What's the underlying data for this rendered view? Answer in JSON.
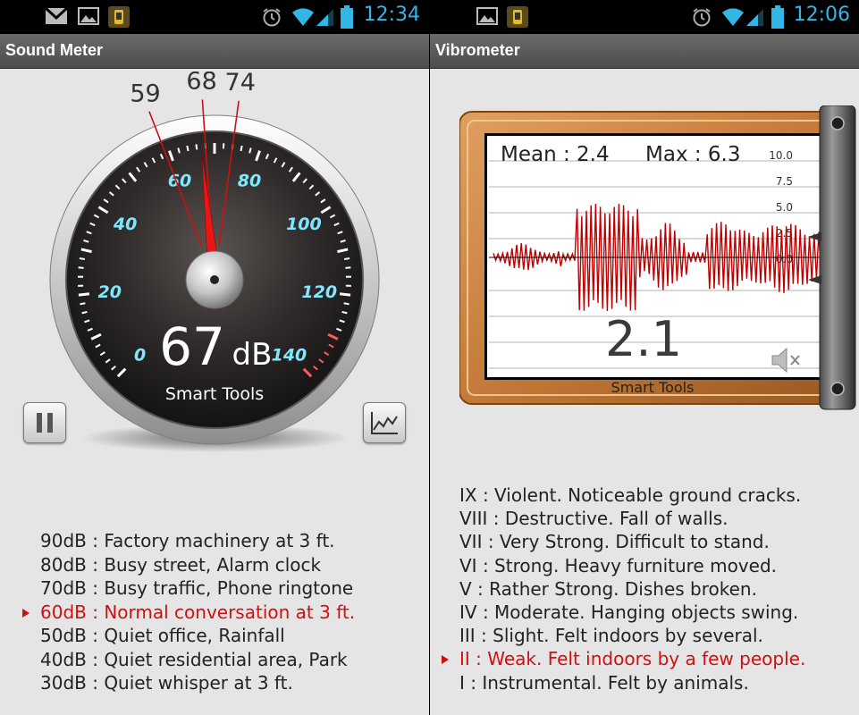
{
  "left": {
    "status": {
      "time": "12:34",
      "icons": [
        "gmail-icon",
        "gallery-icon",
        "app-icon",
        "alarm-icon",
        "wifi-icon",
        "signal-icon",
        "battery-icon"
      ]
    },
    "title": "Sound Meter",
    "gauge": {
      "markers": [
        "59",
        "68",
        "74"
      ],
      "marker_values": [
        59,
        68,
        74
      ],
      "needle_value": 67,
      "scale_labels": [
        "0",
        "20",
        "40",
        "60",
        "80",
        "100",
        "120",
        "140"
      ],
      "reading": "67",
      "unit": "dB",
      "brand": "Smart Tools"
    },
    "pause_icon": "pause-icon",
    "chart_icon": "chart-icon",
    "references": [
      "90dB : Factory machinery at 3 ft.",
      "80dB : Busy street, Alarm clock",
      "70dB : Busy traffic, Phone ringtone",
      "60dB : Normal conversation at 3 ft.",
      "50dB : Quiet office, Rainfall",
      "40dB : Quiet residential area, Park",
      "30dB : Quiet whisper at 3 ft."
    ],
    "active_index": 3,
    "accent": "#d01010",
    "scale_color": "#7fe8ff"
  },
  "right": {
    "status": {
      "time": "12:06",
      "icons": [
        "gallery-icon",
        "app-icon",
        "alarm-icon",
        "wifi-icon",
        "signal-icon",
        "battery-icon"
      ]
    },
    "title": "Vibrometer",
    "screen": {
      "mean": "Mean : 2.4",
      "max": "Max : 6.3",
      "y_ticks": [
        "10.0",
        "7.5",
        "5.0",
        "2.5",
        "0.0"
      ],
      "reading": "2.1",
      "brand": "Smart Tools",
      "mute_icon": "speaker-muted-icon"
    },
    "references": [
      "IX : Violent. Noticeable ground cracks.",
      "VIII : Destructive. Fall of walls.",
      "VII : Very Strong. Difficult to stand.",
      "VI : Strong. Heavy furniture moved.",
      "V  : Rather Strong. Dishes broken.",
      "IV : Moderate. Hanging objects swing.",
      "III : Slight. Felt indoors by several.",
      "II : Weak. Felt indoors by a few people.",
      "I  : Instrumental. Felt by animals."
    ],
    "active_index": 7,
    "accent": "#d01010"
  }
}
